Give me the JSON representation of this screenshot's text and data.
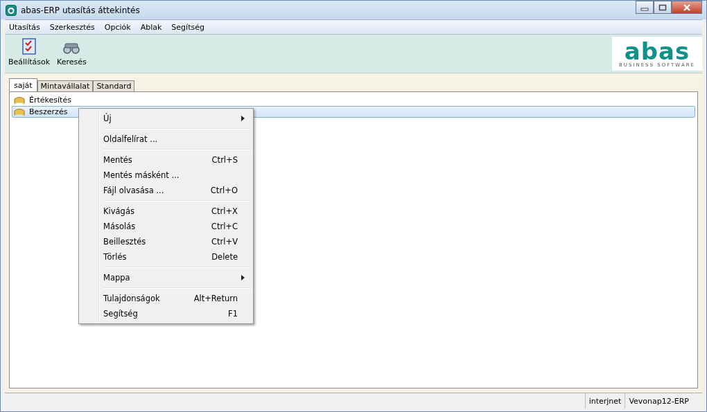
{
  "window": {
    "title": "abas-ERP utasítás áttekintés"
  },
  "menu_bar": [
    "Utasítás",
    "Szerkesztés",
    "Opciók",
    "Ablak",
    "Segítség"
  ],
  "toolbar": [
    {
      "label": "Beállítások",
      "kind": "checklist"
    },
    {
      "label": "Keresés",
      "kind": "binoculars"
    }
  ],
  "logo": {
    "wordmark": "abas",
    "tagline": "BUSINESS SOFTWARE"
  },
  "tabs": [
    {
      "label": "saját",
      "selected": true
    },
    {
      "label": "Mintavállalat",
      "selected": false
    },
    {
      "label": "Standard",
      "selected": false
    }
  ],
  "tree": [
    {
      "label": "Értékesítés",
      "selected": false
    },
    {
      "label": "Beszerzés",
      "selected": true
    }
  ],
  "context_menu": [
    {
      "kind": "item",
      "label": "Új",
      "submenu": true
    },
    {
      "kind": "separator"
    },
    {
      "kind": "item",
      "label": "Oldalfelírat ...",
      "submenu": false
    },
    {
      "kind": "separator"
    },
    {
      "kind": "item",
      "label": "Mentés",
      "shortcut": "Ctrl+S",
      "submenu": false
    },
    {
      "kind": "item",
      "label": "Mentés másként ...",
      "submenu": false
    },
    {
      "kind": "item",
      "label": "Fájl olvasása ...",
      "shortcut": "Ctrl+O",
      "submenu": false
    },
    {
      "kind": "separator"
    },
    {
      "kind": "item",
      "label": "Kivágás",
      "shortcut": "Ctrl+X",
      "submenu": false
    },
    {
      "kind": "item",
      "label": "Másolás",
      "shortcut": "Ctrl+C",
      "submenu": false
    },
    {
      "kind": "item",
      "label": "Beillesztés",
      "shortcut": "Ctrl+V",
      "submenu": false
    },
    {
      "kind": "item",
      "label": "Törlés",
      "shortcut": "Delete",
      "submenu": false
    },
    {
      "kind": "separator"
    },
    {
      "kind": "item",
      "label": "Mappa",
      "submenu": true
    },
    {
      "kind": "separator"
    },
    {
      "kind": "item",
      "label": "Tulajdonságok",
      "shortcut": "Alt+Return",
      "submenu": false
    },
    {
      "kind": "item",
      "label": "Segítség",
      "shortcut": "F1",
      "submenu": false
    }
  ],
  "status_bar": [
    "interjnet",
    "Vevonap12-ERP"
  ]
}
